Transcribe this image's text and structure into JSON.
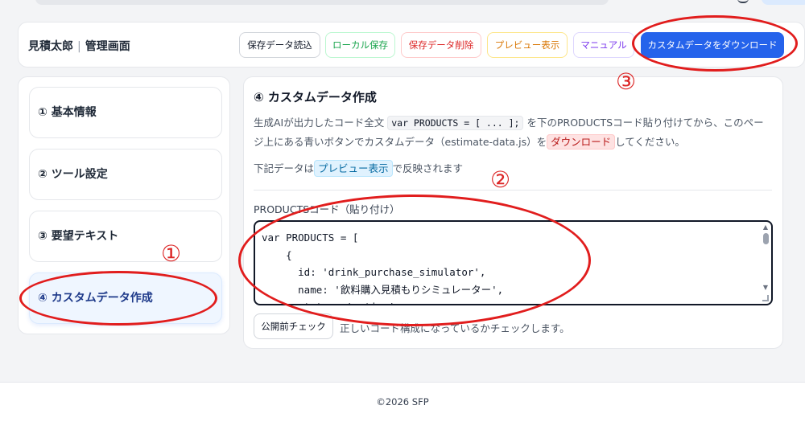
{
  "header": {
    "brand": "見積太郎",
    "brand_sub": "管理画面",
    "buttons": {
      "load": "保存データ読込",
      "local_save": "ローカル保存",
      "delete": "保存データ削除",
      "preview": "プレビュー表示",
      "manual": "マニュアル",
      "download": "カスタムデータをダウンロード"
    }
  },
  "sidebar": {
    "items": [
      {
        "label": "① 基本情報"
      },
      {
        "label": "② ツール設定"
      },
      {
        "label": "③ 要望テキスト"
      },
      {
        "label": "④ カスタムデータ作成"
      }
    ]
  },
  "main": {
    "title": "④ カスタムデータ作成",
    "desc_1": "生成AIが出力したコード全文",
    "desc_code": "var PRODUCTS = [ ... ];",
    "desc_2": "を下のPRODUCTSコード貼り付けてから、このページ上にある青いボタンでカスタムデータ（estimate-data.js）を",
    "desc_chip": "ダウンロード",
    "desc_3": "してください。",
    "note_1": "下記データは",
    "note_chip": "プレビュー表示",
    "note_2": "で反映されます",
    "field_label": "PRODUCTSコード（貼り付け）",
    "code_value": "var PRODUCTS = [\n    {\n      id: 'drink_purchase_simulator',\n      name: '飲料購入見積もりシミュレーター',\n      status: 'active',",
    "check_button": "公開前チェック",
    "check_desc": "正しいコード構成になっているかチェックします。"
  },
  "annotations": {
    "mark_1": "①",
    "mark_2": "②",
    "mark_3": "③"
  },
  "footer": {
    "copyright": "©2026 SFP"
  },
  "colors": {
    "primary": "#2563eb",
    "annotation_red": "#e11d1d"
  }
}
